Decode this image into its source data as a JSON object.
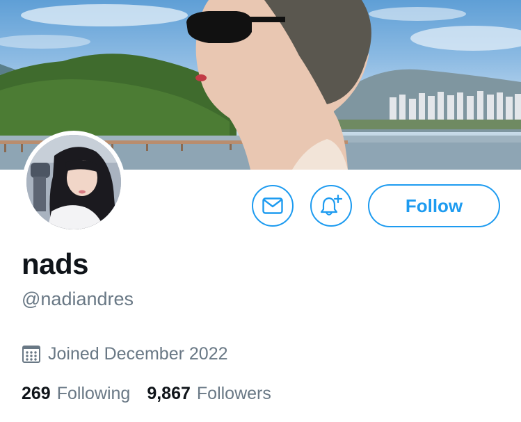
{
  "profile": {
    "display_name": "nads",
    "handle": "@nadiandres",
    "joined": "Joined December 2022"
  },
  "actions": {
    "message_icon": "envelope-icon",
    "notify_icon": "bell-plus-icon",
    "follow_label": "Follow"
  },
  "stats": {
    "following_count": "269",
    "following_label": "Following",
    "followers_count": "9,867",
    "followers_label": "Followers"
  },
  "colors": {
    "accent": "#1d9bf0",
    "text_primary": "#0f1419",
    "text_secondary": "#697885"
  }
}
